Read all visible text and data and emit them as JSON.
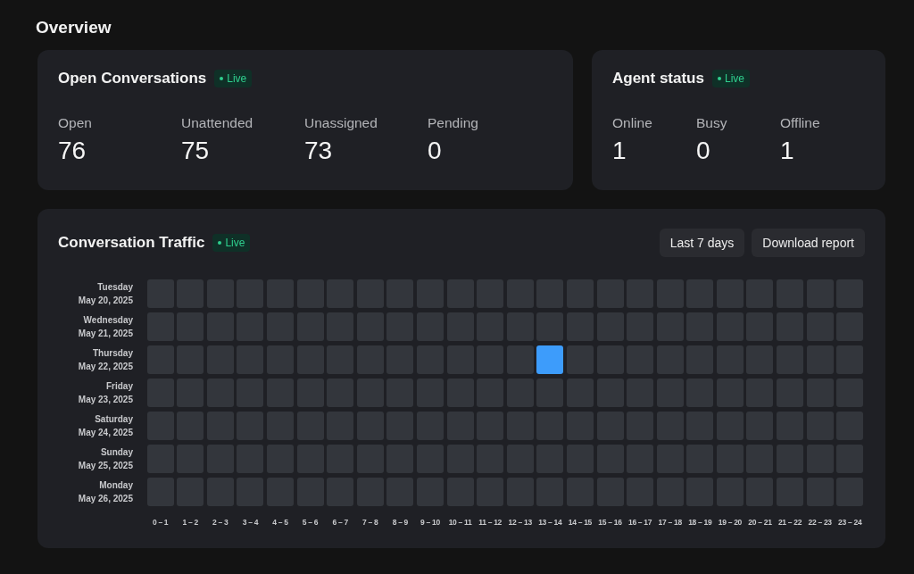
{
  "title": "Overview",
  "open_conversations": {
    "title": "Open Conversations",
    "badge": "Live",
    "stats": [
      {
        "label": "Open",
        "value": "76"
      },
      {
        "label": "Unattended",
        "value": "75"
      },
      {
        "label": "Unassigned",
        "value": "73"
      },
      {
        "label": "Pending",
        "value": "0"
      }
    ]
  },
  "agent_status": {
    "title": "Agent status",
    "badge": "Live",
    "stats": [
      {
        "label": "Online",
        "value": "1"
      },
      {
        "label": "Busy",
        "value": "0"
      },
      {
        "label": "Offline",
        "value": "1"
      }
    ]
  },
  "traffic": {
    "title": "Conversation Traffic",
    "badge": "Live",
    "buttons": [
      "Last 7 days",
      "Download report"
    ],
    "rows": [
      {
        "day": "Tuesday",
        "date": "May 20, 2025",
        "cells": [
          {
            "highlighted": false
          },
          {
            "highlighted": false
          },
          {
            "highlighted": false
          },
          {
            "highlighted": false
          },
          {
            "highlighted": false
          },
          {
            "highlighted": false
          },
          {
            "highlighted": false
          },
          {
            "highlighted": false
          },
          {
            "highlighted": false
          },
          {
            "highlighted": false
          },
          {
            "highlighted": false
          },
          {
            "highlighted": false
          },
          {
            "highlighted": false
          },
          {
            "highlighted": false
          },
          {
            "highlighted": false
          },
          {
            "highlighted": false
          },
          {
            "highlighted": false
          },
          {
            "highlighted": false
          },
          {
            "highlighted": false
          },
          {
            "highlighted": false
          },
          {
            "highlighted": false
          },
          {
            "highlighted": false
          },
          {
            "highlighted": false
          },
          {
            "highlighted": false
          }
        ]
      },
      {
        "day": "Wednesday",
        "date": "May 21, 2025",
        "cells": [
          {
            "highlighted": false
          },
          {
            "highlighted": false
          },
          {
            "highlighted": false
          },
          {
            "highlighted": false
          },
          {
            "highlighted": false
          },
          {
            "highlighted": false
          },
          {
            "highlighted": false
          },
          {
            "highlighted": false
          },
          {
            "highlighted": false
          },
          {
            "highlighted": false
          },
          {
            "highlighted": false
          },
          {
            "highlighted": false
          },
          {
            "highlighted": false
          },
          {
            "highlighted": false
          },
          {
            "highlighted": false
          },
          {
            "highlighted": false
          },
          {
            "highlighted": false
          },
          {
            "highlighted": false
          },
          {
            "highlighted": false
          },
          {
            "highlighted": false
          },
          {
            "highlighted": false
          },
          {
            "highlighted": false
          },
          {
            "highlighted": false
          },
          {
            "highlighted": false
          }
        ]
      },
      {
        "day": "Thursday",
        "date": "May 22, 2025",
        "cells": [
          {
            "highlighted": false
          },
          {
            "highlighted": false
          },
          {
            "highlighted": false
          },
          {
            "highlighted": false
          },
          {
            "highlighted": false
          },
          {
            "highlighted": false
          },
          {
            "highlighted": false
          },
          {
            "highlighted": false
          },
          {
            "highlighted": false
          },
          {
            "highlighted": false
          },
          {
            "highlighted": false
          },
          {
            "highlighted": false
          },
          {
            "highlighted": false
          },
          {
            "highlighted": true
          },
          {
            "highlighted": false
          },
          {
            "highlighted": false
          },
          {
            "highlighted": false
          },
          {
            "highlighted": false
          },
          {
            "highlighted": false
          },
          {
            "highlighted": false
          },
          {
            "highlighted": false
          },
          {
            "highlighted": false
          },
          {
            "highlighted": false
          },
          {
            "highlighted": false
          }
        ]
      },
      {
        "day": "Friday",
        "date": "May 23, 2025",
        "cells": [
          {
            "highlighted": false
          },
          {
            "highlighted": false
          },
          {
            "highlighted": false
          },
          {
            "highlighted": false
          },
          {
            "highlighted": false
          },
          {
            "highlighted": false
          },
          {
            "highlighted": false
          },
          {
            "highlighted": false
          },
          {
            "highlighted": false
          },
          {
            "highlighted": false
          },
          {
            "highlighted": false
          },
          {
            "highlighted": false
          },
          {
            "highlighted": false
          },
          {
            "highlighted": false
          },
          {
            "highlighted": false
          },
          {
            "highlighted": false
          },
          {
            "highlighted": false
          },
          {
            "highlighted": false
          },
          {
            "highlighted": false
          },
          {
            "highlighted": false
          },
          {
            "highlighted": false
          },
          {
            "highlighted": false
          },
          {
            "highlighted": false
          },
          {
            "highlighted": false
          }
        ]
      },
      {
        "day": "Saturday",
        "date": "May 24, 2025",
        "cells": [
          {
            "highlighted": false
          },
          {
            "highlighted": false
          },
          {
            "highlighted": false
          },
          {
            "highlighted": false
          },
          {
            "highlighted": false
          },
          {
            "highlighted": false
          },
          {
            "highlighted": false
          },
          {
            "highlighted": false
          },
          {
            "highlighted": false
          },
          {
            "highlighted": false
          },
          {
            "highlighted": false
          },
          {
            "highlighted": false
          },
          {
            "highlighted": false
          },
          {
            "highlighted": false
          },
          {
            "highlighted": false
          },
          {
            "highlighted": false
          },
          {
            "highlighted": false
          },
          {
            "highlighted": false
          },
          {
            "highlighted": false
          },
          {
            "highlighted": false
          },
          {
            "highlighted": false
          },
          {
            "highlighted": false
          },
          {
            "highlighted": false
          },
          {
            "highlighted": false
          }
        ]
      },
      {
        "day": "Sunday",
        "date": "May 25, 2025",
        "cells": [
          {
            "highlighted": false
          },
          {
            "highlighted": false
          },
          {
            "highlighted": false
          },
          {
            "highlighted": false
          },
          {
            "highlighted": false
          },
          {
            "highlighted": false
          },
          {
            "highlighted": false
          },
          {
            "highlighted": false
          },
          {
            "highlighted": false
          },
          {
            "highlighted": false
          },
          {
            "highlighted": false
          },
          {
            "highlighted": false
          },
          {
            "highlighted": false
          },
          {
            "highlighted": false
          },
          {
            "highlighted": false
          },
          {
            "highlighted": false
          },
          {
            "highlighted": false
          },
          {
            "highlighted": false
          },
          {
            "highlighted": false
          },
          {
            "highlighted": false
          },
          {
            "highlighted": false
          },
          {
            "highlighted": false
          },
          {
            "highlighted": false
          },
          {
            "highlighted": false
          }
        ]
      },
      {
        "day": "Monday",
        "date": "May 26, 2025",
        "cells": [
          {
            "highlighted": false
          },
          {
            "highlighted": false
          },
          {
            "highlighted": false
          },
          {
            "highlighted": false
          },
          {
            "highlighted": false
          },
          {
            "highlighted": false
          },
          {
            "highlighted": false
          },
          {
            "highlighted": false
          },
          {
            "highlighted": false
          },
          {
            "highlighted": false
          },
          {
            "highlighted": false
          },
          {
            "highlighted": false
          },
          {
            "highlighted": false
          },
          {
            "highlighted": false
          },
          {
            "highlighted": false
          },
          {
            "highlighted": false
          },
          {
            "highlighted": false
          },
          {
            "highlighted": false
          },
          {
            "highlighted": false
          },
          {
            "highlighted": false
          },
          {
            "highlighted": false
          },
          {
            "highlighted": false
          },
          {
            "highlighted": false
          },
          {
            "highlighted": false
          }
        ]
      }
    ],
    "hours": [
      "0 – 1",
      "1 – 2",
      "2 – 3",
      "3 – 4",
      "4 – 5",
      "5 – 6",
      "6 – 7",
      "7 – 8",
      "8 – 9",
      "9 – 10",
      "10 – 11",
      "11 – 12",
      "12 – 13",
      "13 – 14",
      "14 – 15",
      "15 – 16",
      "16 – 17",
      "17 – 18",
      "18 – 19",
      "19 – 20",
      "20 – 21",
      "21 – 22",
      "22 – 23",
      "23 – 24"
    ]
  }
}
